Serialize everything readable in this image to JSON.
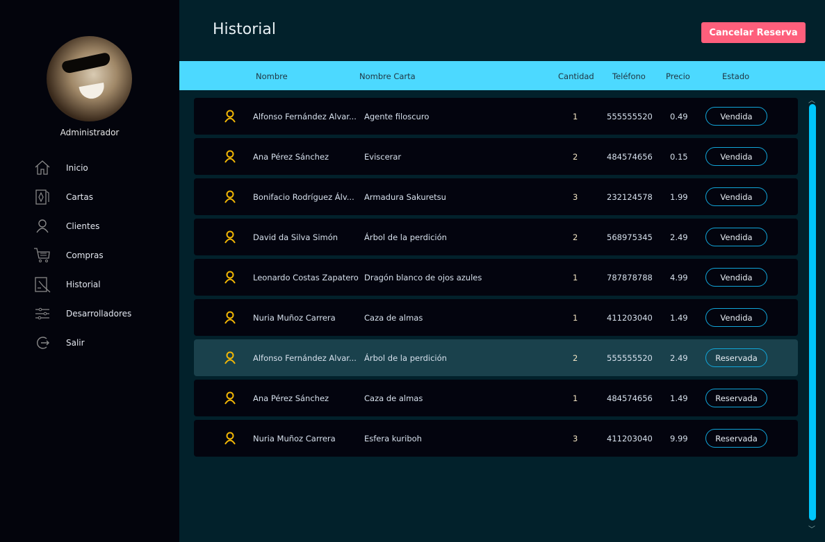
{
  "sidebar": {
    "role": "Administrador",
    "items": [
      {
        "label": "Inicio",
        "icon": "home-icon"
      },
      {
        "label": "Cartas",
        "icon": "card-icon"
      },
      {
        "label": "Clientes",
        "icon": "user-icon"
      },
      {
        "label": "Compras",
        "icon": "cart-icon"
      },
      {
        "label": "Historial",
        "icon": "history-icon"
      },
      {
        "label": "Desarrolladores",
        "icon": "sliders-icon"
      },
      {
        "label": "Salir",
        "icon": "logout-icon"
      }
    ]
  },
  "header": {
    "title": "Historial",
    "cancel_label": "Cancelar Reserva"
  },
  "colors": {
    "accent": "#4cd9ff",
    "cancel": "#fe5f7c",
    "user_icon": "#f2b705"
  },
  "table": {
    "columns": [
      "Nombre",
      "Nombre Carta",
      "Cantidad",
      "Teléfono",
      "Precio",
      "Estado"
    ],
    "rows": [
      {
        "name": "Alfonso Fernández Alvar...",
        "card": "Agente filoscuro",
        "qty": "1",
        "phone": "555555520",
        "price": "0.49",
        "status": "Vendida"
      },
      {
        "name": "Ana Pérez Sánchez",
        "card": "Eviscerar",
        "qty": "2",
        "phone": "484574656",
        "price": "0.15",
        "status": "Vendida"
      },
      {
        "name": "Bonifacio Rodríguez Álv...",
        "card": "Armadura Sakuretsu",
        "qty": "3",
        "phone": "232124578",
        "price": "1.99",
        "status": "Vendida"
      },
      {
        "name": "David da Silva Simón",
        "card": "Árbol de la perdición",
        "qty": "2",
        "phone": "568975345",
        "price": "2.49",
        "status": "Vendida"
      },
      {
        "name": "Leonardo Costas Zapatero",
        "card": "Dragón blanco de ojos azules",
        "qty": "1",
        "phone": "787878788",
        "price": "4.99",
        "status": "Vendida"
      },
      {
        "name": "Nuria Muñoz Carrera",
        "card": "Caza de almas",
        "qty": "1",
        "phone": "411203040",
        "price": "1.49",
        "status": "Vendida"
      },
      {
        "name": "Alfonso Fernández Alvar...",
        "card": "Árbol de la perdición",
        "qty": "2",
        "phone": "555555520",
        "price": "2.49",
        "status": "Reservada",
        "selected": true
      },
      {
        "name": "Ana Pérez Sánchez",
        "card": "Caza de almas",
        "qty": "1",
        "phone": "484574656",
        "price": "1.49",
        "status": "Reservada"
      },
      {
        "name": "Nuria Muñoz Carrera",
        "card": "Esfera kuriboh",
        "qty": "3",
        "phone": "411203040",
        "price": "9.99",
        "status": "Reservada"
      }
    ]
  }
}
